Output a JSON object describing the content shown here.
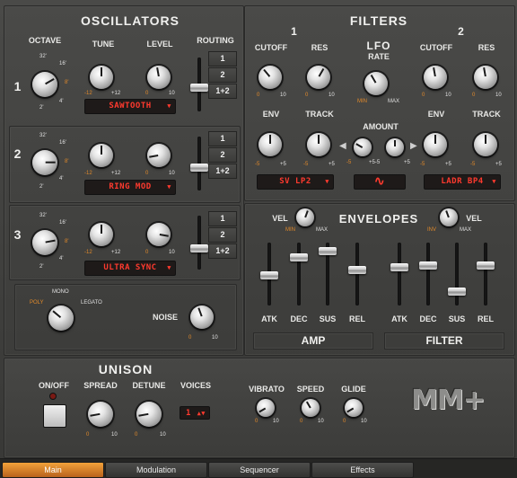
{
  "oscillators": {
    "title": "OSCILLATORS",
    "column_labels": {
      "octave": "OCTAVE",
      "tune": "TUNE",
      "level": "LEVEL",
      "routing": "ROUTING"
    },
    "octave_marks": [
      "32'",
      "16'",
      "8'",
      "4'",
      "2'"
    ],
    "tune_range": {
      "min": "-12",
      "max": "+12"
    },
    "level_range": {
      "min": "0",
      "max": "10"
    },
    "routing_options": [
      "1",
      "2",
      "1+2"
    ],
    "rows": [
      {
        "number": "1",
        "waveform": "SAWTOOTH"
      },
      {
        "number": "2",
        "waveform": "RING MOD"
      },
      {
        "number": "3",
        "waveform": "ULTRA SYNC"
      }
    ]
  },
  "voice_mode": {
    "options": [
      "POLY",
      "MONO",
      "LEGATO"
    ],
    "selected": "POLY",
    "noise_label": "NOISE",
    "noise_range": {
      "min": "0",
      "max": "10"
    }
  },
  "filters": {
    "title": "FILTERS",
    "filter1": {
      "number": "1",
      "cutoff": "CUTOFF",
      "res": "RES",
      "env": "ENV",
      "track": "TRACK",
      "type": "SV LP2",
      "range_0": "0",
      "range_10": "10",
      "env_min": "-5",
      "env_max": "+5"
    },
    "filter2": {
      "number": "2",
      "cutoff": "CUTOFF",
      "res": "RES",
      "env": "ENV",
      "track": "TRACK",
      "type": "LADR BP4",
      "range_0": "0",
      "range_10": "10",
      "env_min": "-5",
      "env_max": "+5"
    },
    "lfo": {
      "title": "LFO",
      "rate": "RATE",
      "rate_min": "MIN",
      "rate_max": "MAX",
      "amount": "AMOUNT",
      "amt_min": "-5",
      "amt_mid": "+5-5",
      "amt_max": "+5",
      "waveform_symbol": "∿"
    }
  },
  "envelopes": {
    "title": "ENVELOPES",
    "vel_label": "VEL",
    "amp_vel": {
      "min": "MIN",
      "max": "MAX"
    },
    "filter_vel": {
      "min": "INV",
      "max": "MAX"
    },
    "amp_label": "AMP",
    "filter_label": "FILTER",
    "stage_labels": [
      "ATK",
      "DEC",
      "SUS",
      "REL"
    ]
  },
  "unison": {
    "title": "UNISON",
    "on_off": "ON/OFF",
    "spread": "SPREAD",
    "detune": "DETUNE",
    "voices": "VOICES",
    "voices_value": "1",
    "range": {
      "min": "0",
      "max": "10"
    }
  },
  "performance": {
    "vibrato": "VIBRATO",
    "speed": "SPEED",
    "glide": "GLIDE",
    "range": {
      "min": "0",
      "max": "10"
    }
  },
  "logo": "MM+",
  "tabs": [
    {
      "label": "Main",
      "active": true
    },
    {
      "label": "Modulation",
      "active": false
    },
    {
      "label": "Sequencer",
      "active": false
    },
    {
      "label": "Effects",
      "active": false
    }
  ]
}
